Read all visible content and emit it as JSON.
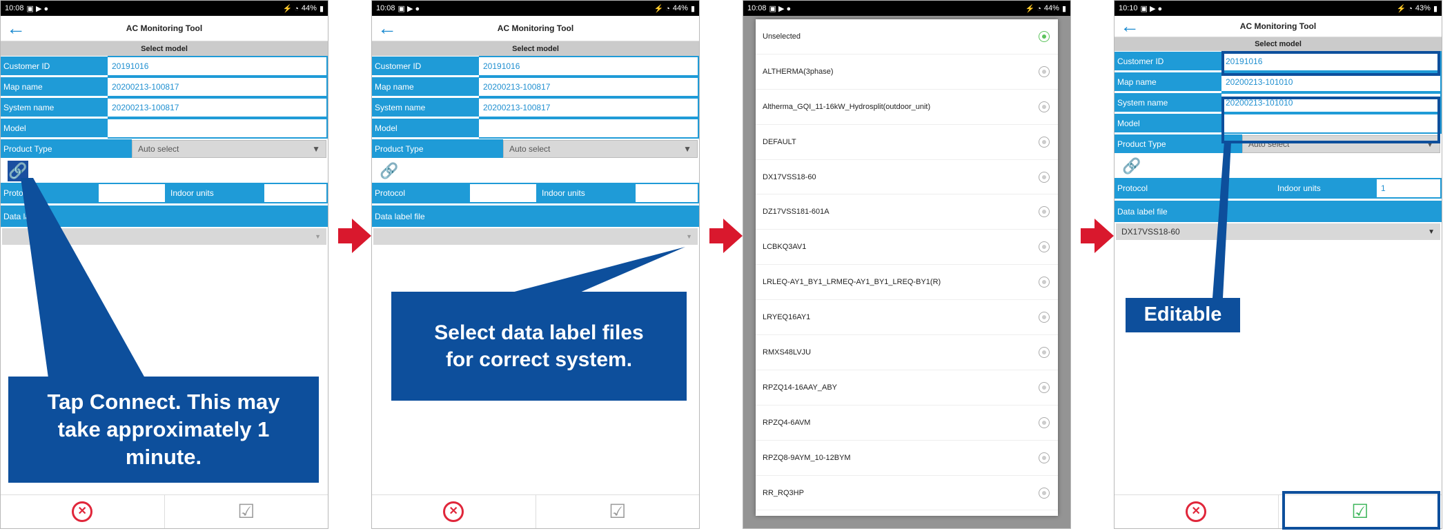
{
  "app_title": "AC Monitoring Tool",
  "subheader": "Select model",
  "panel1": {
    "time": "10:08",
    "battery": "44%",
    "fields": {
      "customer_id": {
        "label": "Customer ID",
        "value": "20191016"
      },
      "map_name": {
        "label": "Map name",
        "value": "20200213-100817"
      },
      "system_name": {
        "label": "System name",
        "value": "20200213-100817"
      },
      "model": {
        "label": "Model",
        "value": ""
      }
    },
    "product_type": {
      "label": "Product Type",
      "value": "Auto select"
    },
    "protocol_label": "Protocol",
    "indoor_units_label": "Indoor units",
    "data_label_file": "Data label file",
    "callout": "Tap Connect. This may take approximately 1 minute."
  },
  "panel2": {
    "time": "10:08",
    "battery": "44%",
    "fields": {
      "customer_id": {
        "label": "Customer ID",
        "value": "20191016"
      },
      "map_name": {
        "label": "Map name",
        "value": "20200213-100817"
      },
      "system_name": {
        "label": "System name",
        "value": "20200213-100817"
      },
      "model": {
        "label": "Model",
        "value": ""
      }
    },
    "product_type": {
      "label": "Product Type",
      "value": "Auto select"
    },
    "protocol_label": "Protocol",
    "indoor_units_label": "Indoor units",
    "data_label_file": "Data label file",
    "callout": "Select data label files for correct system."
  },
  "panel3": {
    "time": "10:08",
    "battery": "44%",
    "options": [
      "Unselected",
      "ALTHERMA(3phase)",
      "Altherma_GQI_11-16kW_Hydrosplit(outdoor_unit)",
      "DEFAULT",
      "DX17VSS18-60",
      "DZ17VSS181-601A",
      "LCBKQ3AV1",
      "LRLEQ-AY1_BY1_LRMEQ-AY1_BY1_LREQ-BY1(R)",
      "LRYEQ16AY1",
      "RMXS48LVJU",
      "RPZQ14-16AAY_ABY",
      "RPZQ4-6AVM",
      "RPZQ8-9AYM_10-12BYM",
      "RR_RQ3HP"
    ],
    "selected_index": 0
  },
  "panel4": {
    "time": "10:10",
    "battery": "43%",
    "fields": {
      "customer_id": {
        "label": "Customer ID",
        "value": "20191016"
      },
      "map_name": {
        "label": "Map name",
        "value": "20200213-101010"
      },
      "system_name": {
        "label": "System name",
        "value": "20200213-101010"
      },
      "model": {
        "label": "Model",
        "value": ""
      }
    },
    "product_type": {
      "label": "Product Type",
      "value": "Auto select"
    },
    "protocol_label": "Protocol",
    "indoor_units_label": "Indoor units",
    "indoor_units_value": "1",
    "data_label_file": "Data label file",
    "data_label_file_value": "DX17VSS18-60",
    "callout": "Editable"
  },
  "icons": {
    "back": "back-arrow-icon",
    "link": "link-icon",
    "cancel": "cancel-icon",
    "confirm": "checkbox-confirm-icon"
  },
  "colors": {
    "field_blue": "#1f9bd7",
    "callout_navy": "#0d4f9c",
    "arrow_red": "#d9182d",
    "cancel_red": "#e0263a",
    "confirm_green": "#3cb55a"
  }
}
